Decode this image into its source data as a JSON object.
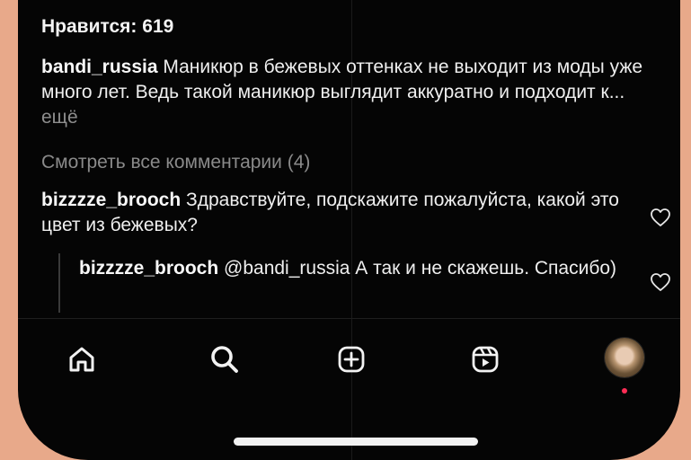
{
  "post": {
    "likes_text": "Нравится: 619",
    "caption_user": "bandi_russia",
    "caption_text": " Маникюр в бежевых оттенках не выходит из моды уже много лет. Ведь такой маникюр выглядит аккуратно и подходит к...",
    "more_label": " ещё",
    "view_all_comments": "Смотреть все комментарии (4)"
  },
  "comments": [
    {
      "user": "bizzzze_brooch",
      "text": " Здравствуйте, подскажите пожалуйста, какой это цвет из бежевых?"
    },
    {
      "user": "bizzzze_brooch",
      "text": " @bandi_russia А так и не скажешь. Спасибо)"
    }
  ],
  "nav": {
    "icons": [
      "home-icon",
      "search-icon",
      "create-post-icon",
      "reels-icon",
      "profile-avatar"
    ],
    "notification_color": "#ff2d55"
  },
  "colors": {
    "background": "#e8a98a",
    "screen": "#050505"
  }
}
